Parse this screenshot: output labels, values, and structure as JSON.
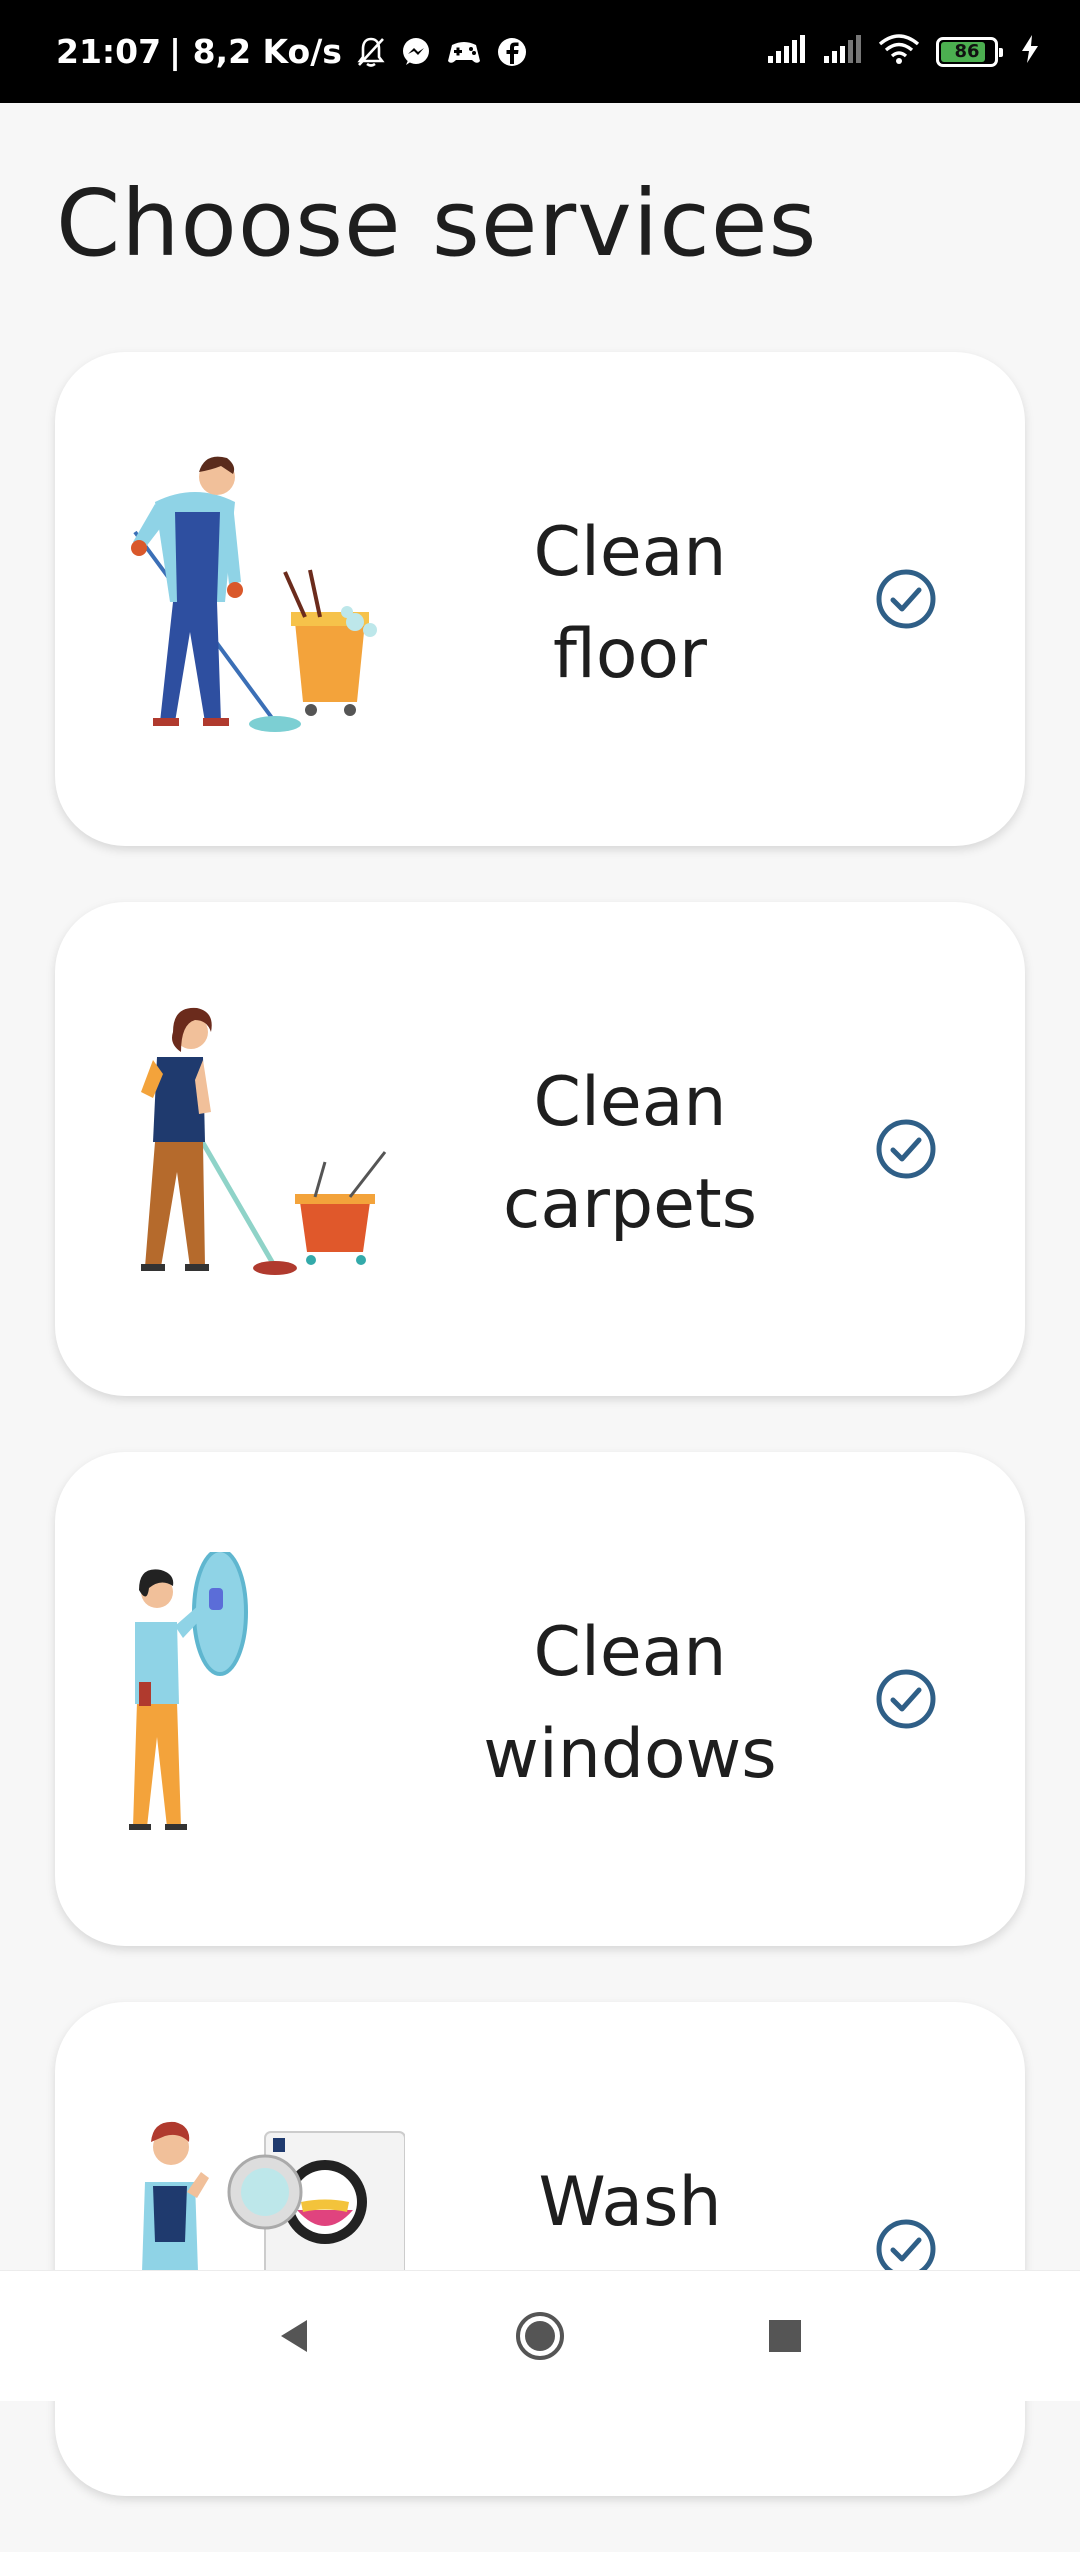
{
  "status_bar": {
    "time": "21:07",
    "network_speed": "| 8,2 Ko/s",
    "battery_level": "86",
    "battery_fraction": 0.86,
    "icons": [
      "mute-bell-icon",
      "messenger-icon",
      "gamepad-icon",
      "facebook-icon",
      "signal-icon",
      "signal-icon",
      "wifi-icon",
      "battery-icon",
      "charging-bolt-icon"
    ]
  },
  "page": {
    "title": "Choose services"
  },
  "services": [
    {
      "label": "Clean\nfloor",
      "icon": "man-mopping-illustration",
      "selected": true
    },
    {
      "label": "Clean\ncarpets",
      "icon": "woman-mopping-illustration",
      "selected": true
    },
    {
      "label": "Clean\nwindows",
      "icon": "woman-cleaning-window-illustration",
      "selected": true
    },
    {
      "label": "Wash",
      "icon": "woman-washing-machine-illustration",
      "selected": true
    }
  ],
  "nav_bar": {
    "icons": [
      "back-icon",
      "home-icon",
      "recents-icon"
    ]
  },
  "colors": {
    "accent": "#2f5f87",
    "background": "#f7f7f7",
    "card": "#ffffff",
    "text": "#1e1e1e"
  }
}
